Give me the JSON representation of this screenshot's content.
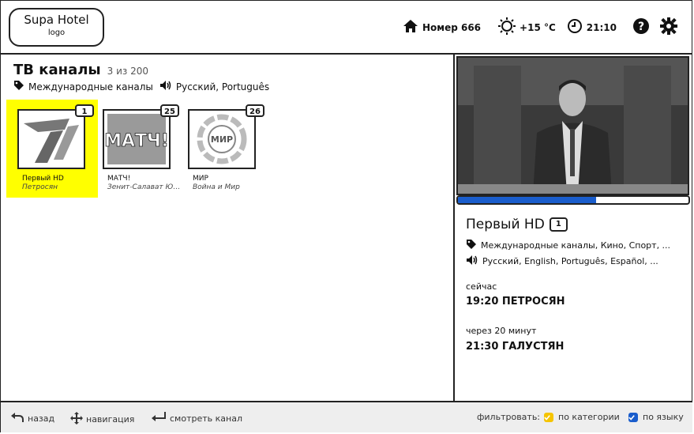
{
  "header": {
    "logo_title": "Supa Hotel",
    "logo_sub": "logo",
    "room": "Номер 666",
    "weather": "+15 °C",
    "time": "21:10",
    "icons": [
      "home-icon",
      "sun-icon",
      "clock-icon",
      "help-icon",
      "gear-icon"
    ]
  },
  "channels": {
    "title": "ТВ каналы",
    "count": "3 из 200",
    "filter_category": "Международные каналы",
    "filter_language": "Русский, Português",
    "items": [
      {
        "number": "1",
        "name": "Первый HD",
        "program": "Петросян",
        "selected": true
      },
      {
        "number": "25",
        "name": "МАТЧ!",
        "program": "Зенит-Салават Юлаев",
        "selected": false
      },
      {
        "number": "26",
        "name": "МИР",
        "program": "Война и Мир",
        "selected": false
      }
    ]
  },
  "preview": {
    "progress": 0.6,
    "channel_name": "Первый HD",
    "channel_number": "1",
    "categories": "Международные каналы, Кино, Спорт, ...",
    "languages": "Русский, English, Português, Español, ...",
    "now_label": "сейчас",
    "now_program": "19:20 ПЕТРОСЯН",
    "next_label": "через 20 минут",
    "next_program": "21:30 ГАЛУСТЯН"
  },
  "footer": {
    "back": "назад",
    "navigation": "навигация",
    "watch": "смотреть канал",
    "filter_label": "фильтровать:",
    "by_category": "по категории",
    "by_language": "по языку",
    "colors": {
      "category_checkbox": "#f5c400",
      "language_checkbox": "#1a5dcc"
    }
  }
}
